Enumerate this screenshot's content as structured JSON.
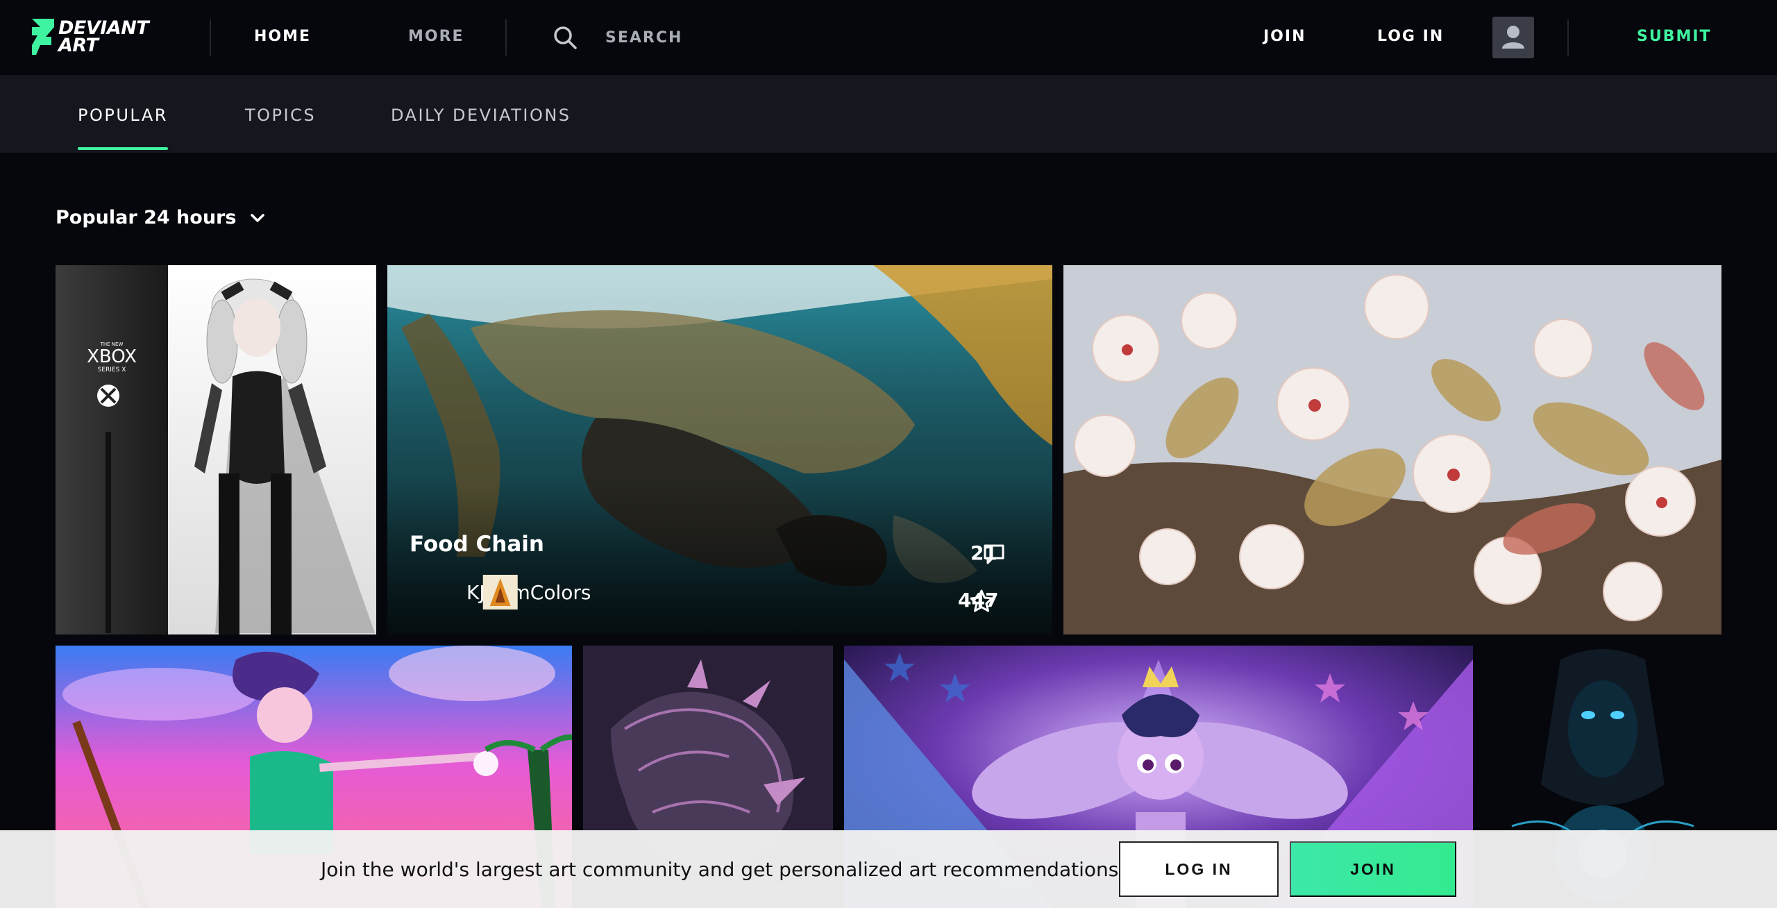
{
  "colors": {
    "accent": "#3ff4a0",
    "background": "#06070d",
    "tabbar": "#14171d"
  },
  "header": {
    "logo_text": "DEVIANT\nART",
    "nav": {
      "home": "HOME",
      "more": "MORE"
    },
    "search": {
      "label": "SEARCH",
      "icon": "search-icon"
    },
    "join": "JOIN",
    "login": "LOG IN",
    "avatar_icon": "user-silhouette-icon",
    "submit": "SUBMIT"
  },
  "tabs": [
    {
      "label": "POPULAR",
      "active": true
    },
    {
      "label": "TOPICS",
      "active": false
    },
    {
      "label": "DAILY DEVIATIONS",
      "active": false
    }
  ],
  "filter": {
    "label": "Popular 24 hours",
    "icon": "chevron-down-icon"
  },
  "featured": {
    "title": "Food Chain",
    "author": "KJfromColors",
    "comments": "21",
    "favourites": "447",
    "comment_icon": "comment-icon",
    "fav_icon": "star-icon"
  },
  "tile_text": {
    "xbox_small": "THE NEW",
    "xbox_big": "XBOX",
    "xbox_series": "SERIES X"
  },
  "banner": {
    "message": "Join the world's largest art community and get personalized art recommendations.",
    "login": "LOG IN",
    "join": "JOIN"
  }
}
